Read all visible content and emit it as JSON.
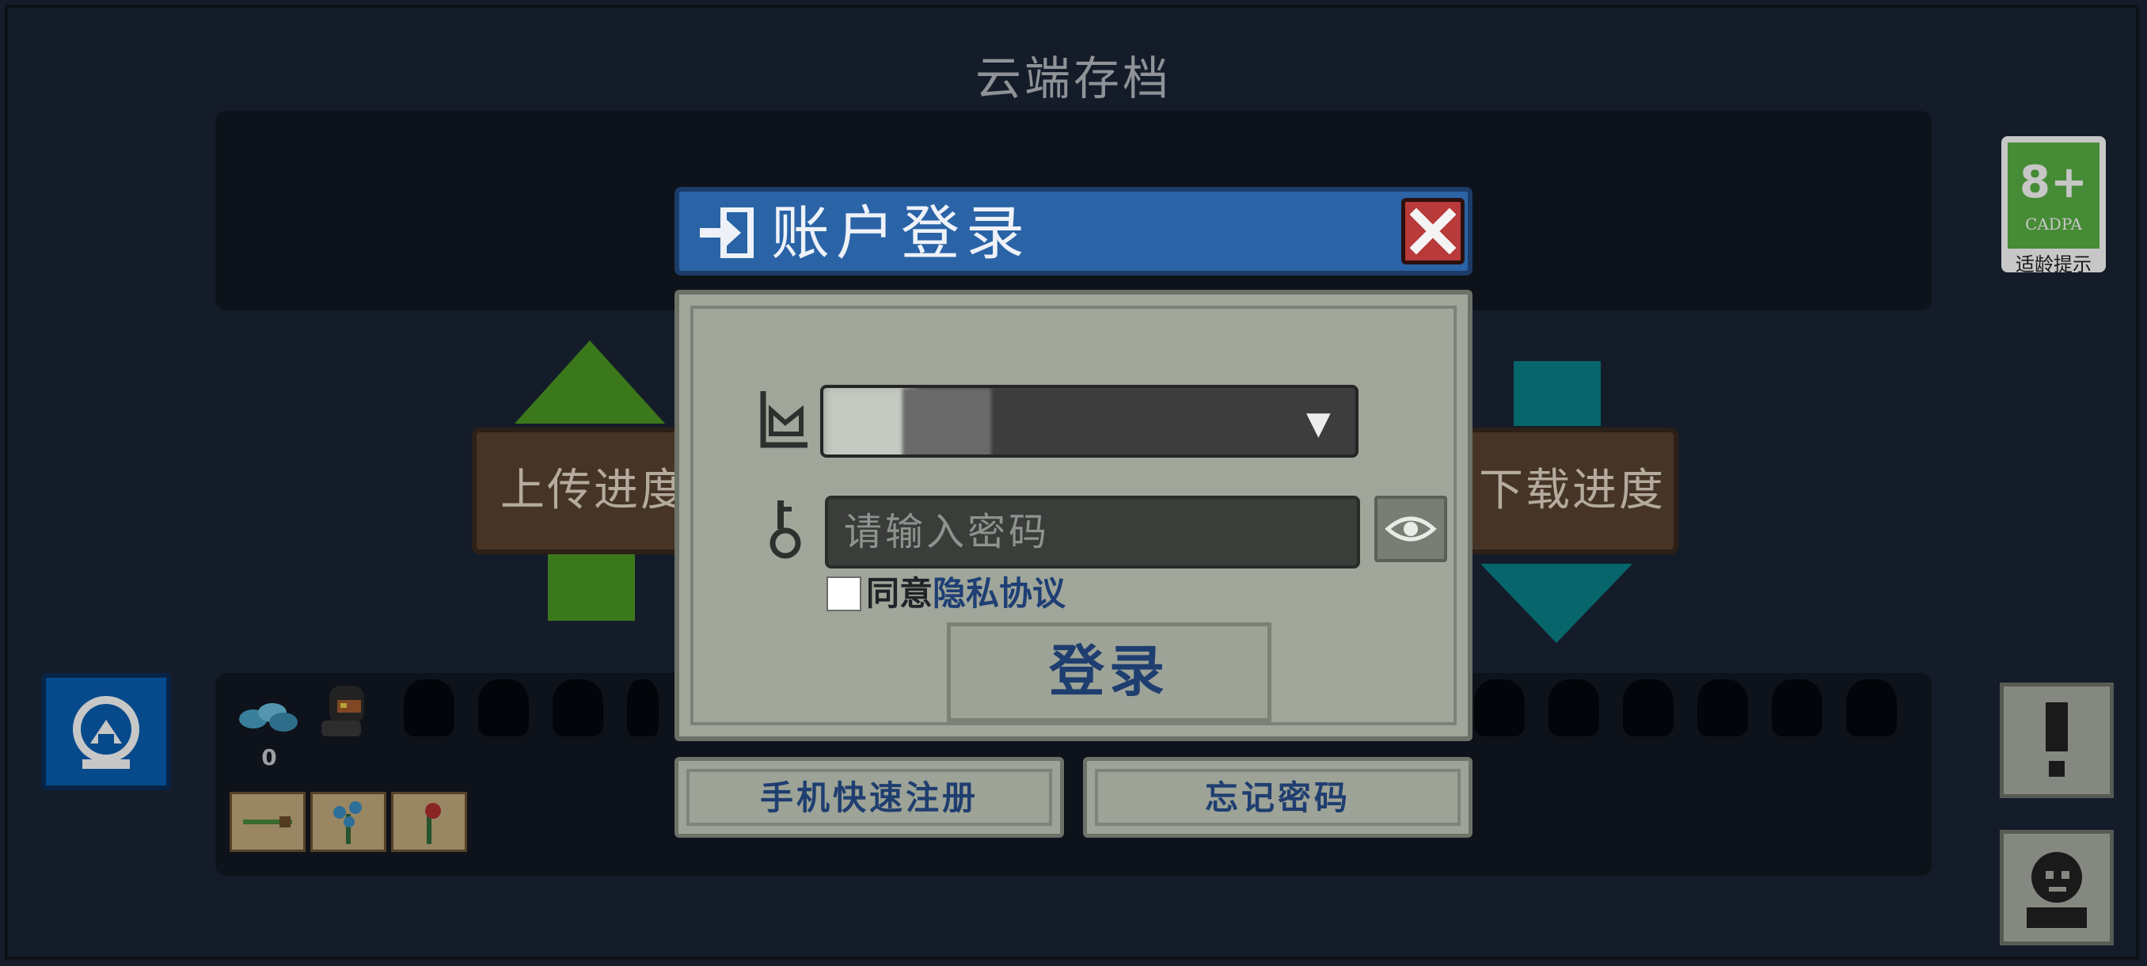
{
  "screen": {
    "title": "云端存档"
  },
  "actions": {
    "upload_label": "上传进度",
    "download_label": "下载进度"
  },
  "rating": {
    "age": "8+",
    "org": "CADPA",
    "caption": "适龄提示"
  },
  "inventory": {
    "gem_count": "0"
  },
  "login_dialog": {
    "title": "账户登录",
    "account_value": "",
    "password_placeholder": "请输入密码",
    "agree_prefix": "同意",
    "privacy_link": "隐私协议",
    "login_button": "登录",
    "register_button": "手机快速注册",
    "forgot_button": "忘记密码"
  },
  "colors": {
    "upload_arrow": "#4c9a23",
    "download_arrow": "#08838b",
    "dialog_header": "#2a63a6",
    "dialog_body": "#a0a69a",
    "link": "#1e3f74"
  },
  "icons": [
    "login-icon",
    "close-icon",
    "account-icon",
    "key-icon",
    "eye-icon",
    "chevron-down-icon",
    "exclamation-icon",
    "profile-icon",
    "gem-icon",
    "character-icon",
    "studio-logo-icon"
  ]
}
